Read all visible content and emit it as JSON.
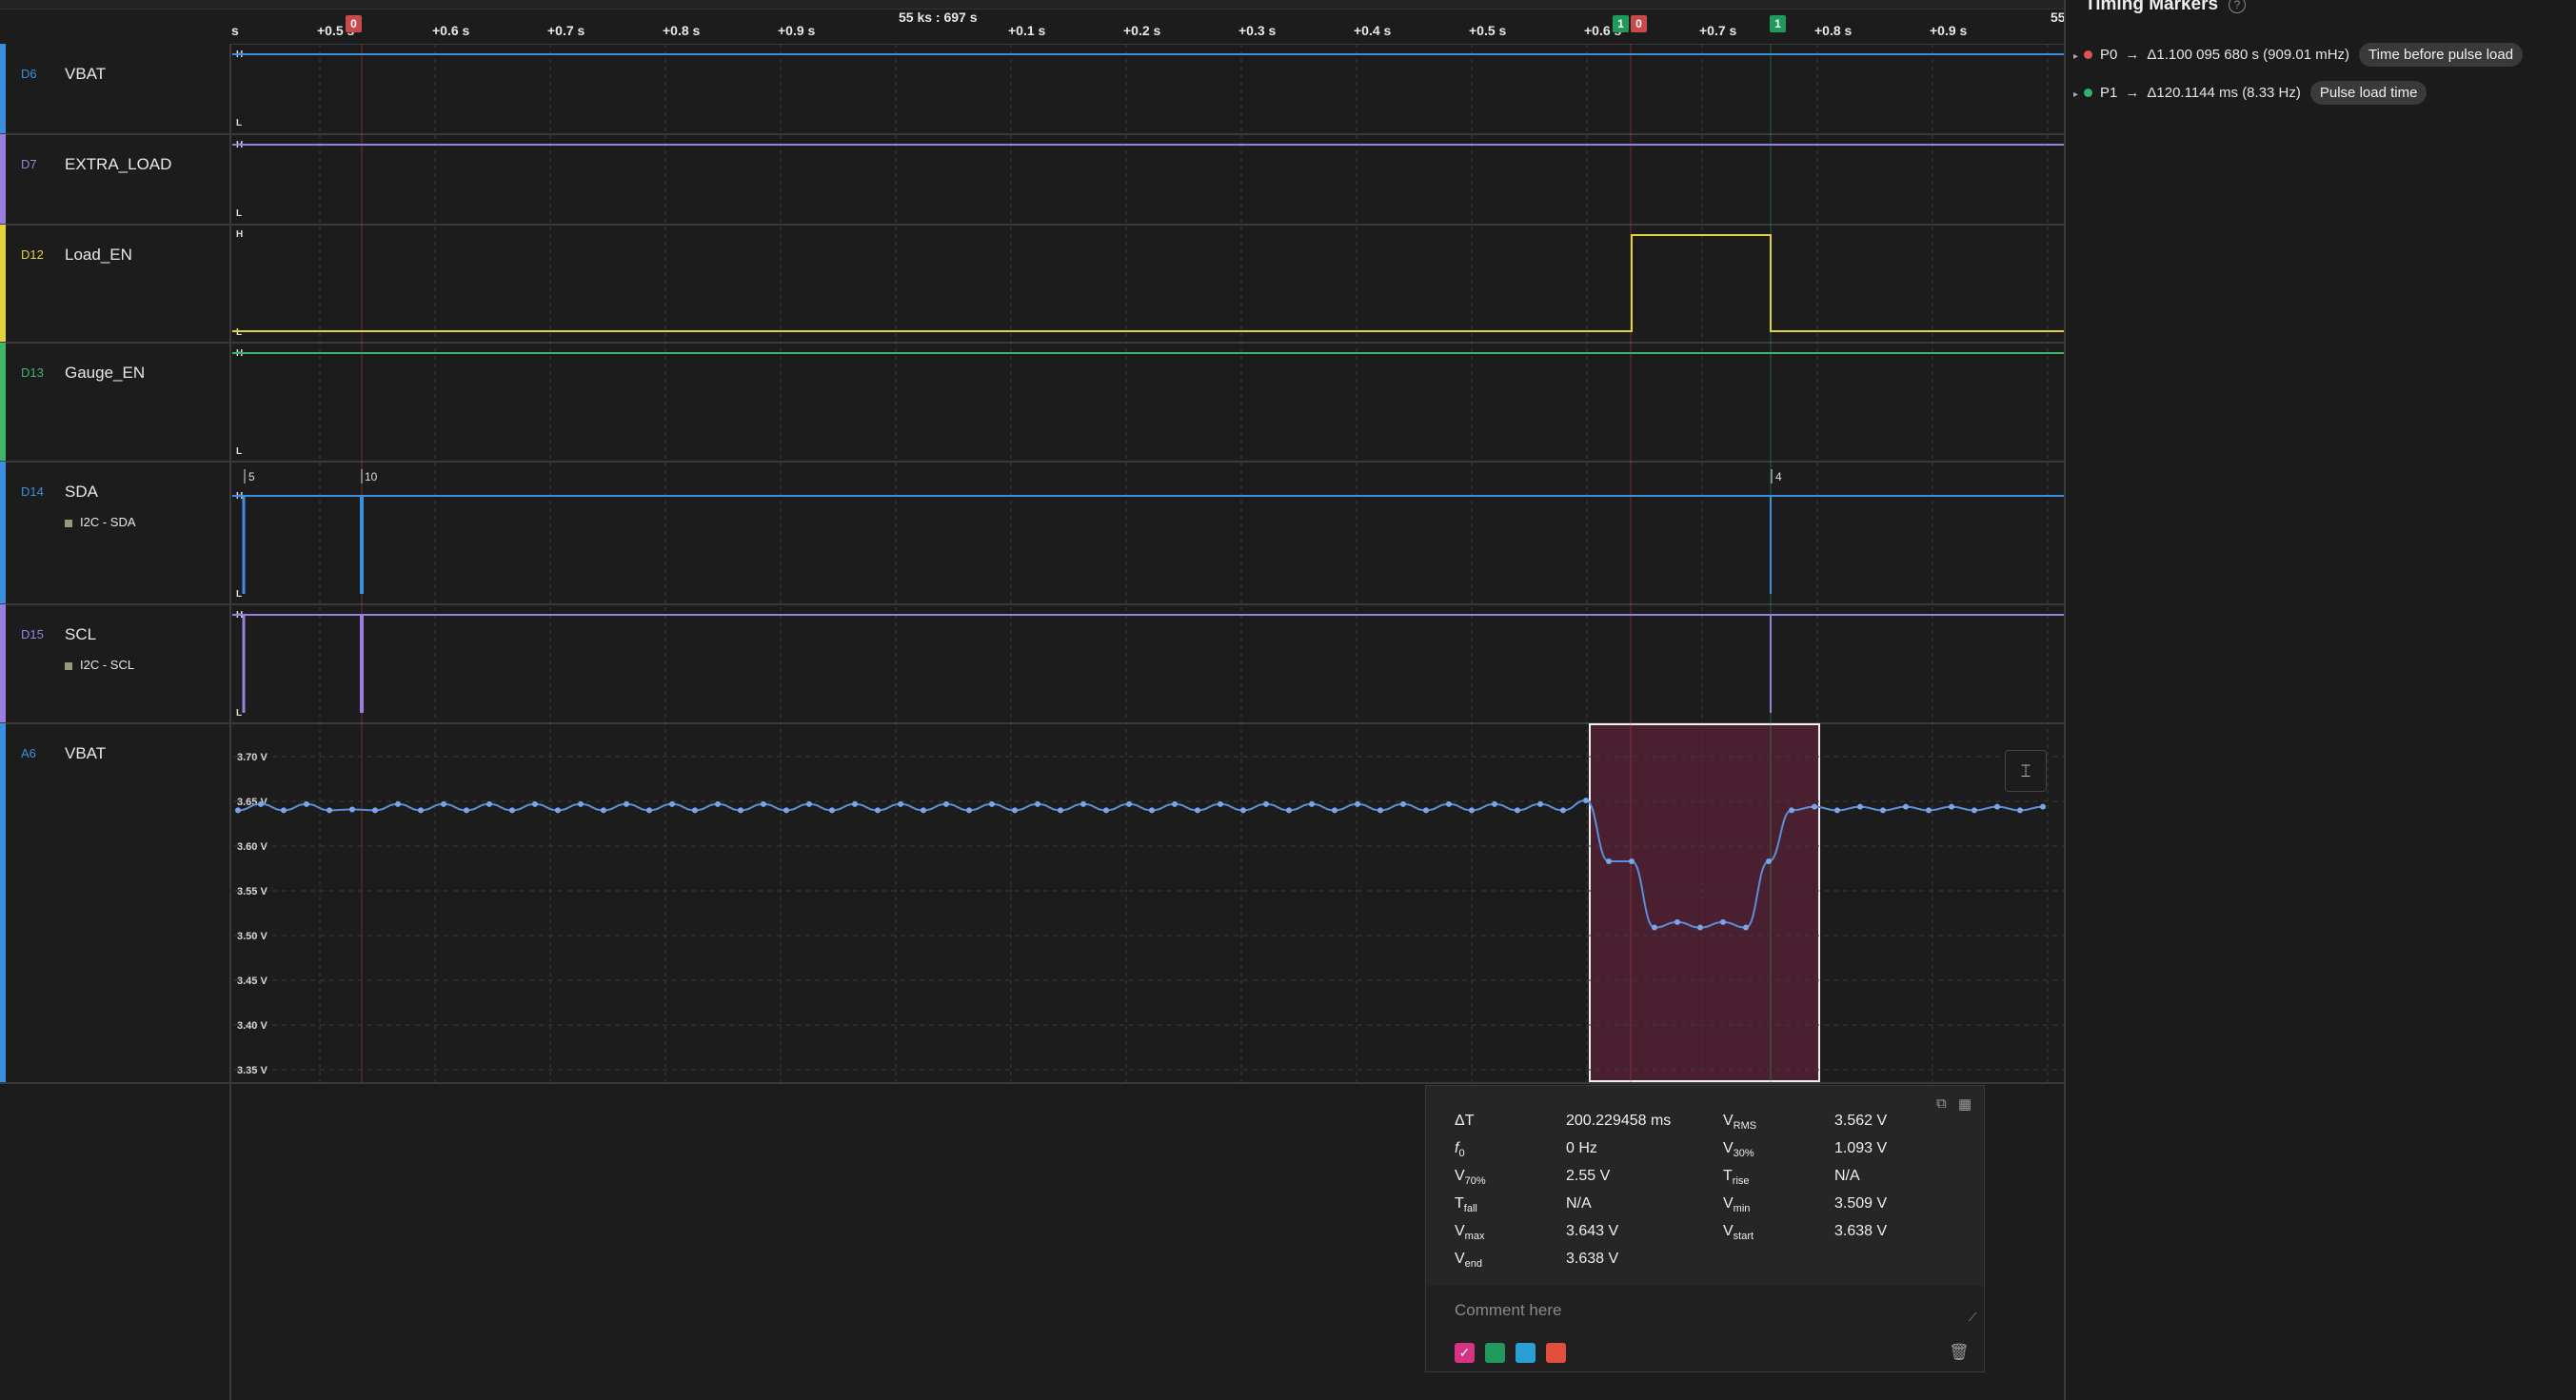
{
  "time_axis": {
    "center_label": "55 ks : 697 s",
    "start_label": "s",
    "end_label": "55",
    "ticks": [
      "+0.5 s",
      "+0.6 s",
      "+0.7 s",
      "+0.8 s",
      "+0.9 s",
      "+0.1 s",
      "+0.2 s",
      "+0.3 s",
      "+0.4 s",
      "+0.5 s",
      "+0.6 s",
      "+0.7 s",
      "+0.8 s",
      "+0.9 s"
    ],
    "markers": [
      {
        "label": "0",
        "color": "red"
      },
      {
        "label": "1",
        "color": "green"
      },
      {
        "label": "0",
        "color": "red"
      },
      {
        "label": "1",
        "color": "green"
      }
    ]
  },
  "channels": [
    {
      "id": "D6",
      "name": "VBAT",
      "color": "#3b8fe0",
      "id_color": "#3b8fe0"
    },
    {
      "id": "D7",
      "name": "EXTRA_LOAD",
      "color": "#9b7fe0",
      "id_color": "#9b7fe0"
    },
    {
      "id": "D12",
      "name": "Load_EN",
      "color": "#e4d23c",
      "id_color": "#e4d23c"
    },
    {
      "id": "D13",
      "name": "Gauge_EN",
      "color": "#3fb56a",
      "id_color": "#3fb56a"
    },
    {
      "id": "D14",
      "name": "SDA",
      "color": "#3b8fe0",
      "id_color": "#3b8fe0",
      "protocol": "I2C - SDA",
      "i2c_labels": [
        "5",
        "10",
        "4"
      ]
    },
    {
      "id": "D15",
      "name": "SCL",
      "color": "#9b7fe0",
      "id_color": "#9b7fe0",
      "protocol": "I2C - SCL"
    },
    {
      "id": "A6",
      "name": "VBAT",
      "color": "#3b8fe0",
      "id_color": "#3b8fe0"
    }
  ],
  "level_labels": {
    "high": "H",
    "low": "L"
  },
  "analog": {
    "y_ticks": [
      "3.70 V",
      "3.65 V",
      "3.60 V",
      "3.55 V",
      "3.50 V",
      "3.45 V",
      "3.40 V",
      "3.35 V"
    ],
    "y_min": 3.35,
    "y_max": 3.7,
    "baseline_v": 3.643,
    "dip_min_v": 3.509
  },
  "timing_markers": {
    "title": "Timing Markers",
    "help_icon": "?",
    "rows": [
      {
        "name": "P0",
        "color": "#e05252",
        "delta": "Δ1.100 095 680 s (909.01 mHz)",
        "tag": "Time before pulse load"
      },
      {
        "name": "P1",
        "color": "#2fb36a",
        "delta": "Δ120.1144 ms (8.33 Hz)",
        "tag": "Pulse load time"
      }
    ]
  },
  "measurement": {
    "left": [
      {
        "sym": "ΔT",
        "sub": "",
        "value": "200.229458 ms"
      },
      {
        "sym": "f",
        "sub": "0",
        "value": "0 Hz"
      },
      {
        "sym": "V",
        "sub": "70%",
        "value": "2.55 V"
      },
      {
        "sym": "T",
        "sub": "fall",
        "value": "N/A"
      },
      {
        "sym": "V",
        "sub": "max",
        "value": "3.643 V"
      },
      {
        "sym": "V",
        "sub": "end",
        "value": "3.638 V"
      }
    ],
    "right": [
      {
        "sym": "V",
        "sub": "RMS",
        "value": "3.562 V"
      },
      {
        "sym": "V",
        "sub": "30%",
        "value": "1.093 V"
      },
      {
        "sym": "T",
        "sub": "rise",
        "value": "N/A"
      },
      {
        "sym": "V",
        "sub": "min",
        "value": "3.509 V"
      },
      {
        "sym": "V",
        "sub": "start",
        "value": "3.638 V"
      }
    ],
    "comment_placeholder": "Comment here",
    "colors": [
      "#d63384",
      "#1f9a5c",
      "#2a9fd6",
      "#e0503a"
    ]
  }
}
